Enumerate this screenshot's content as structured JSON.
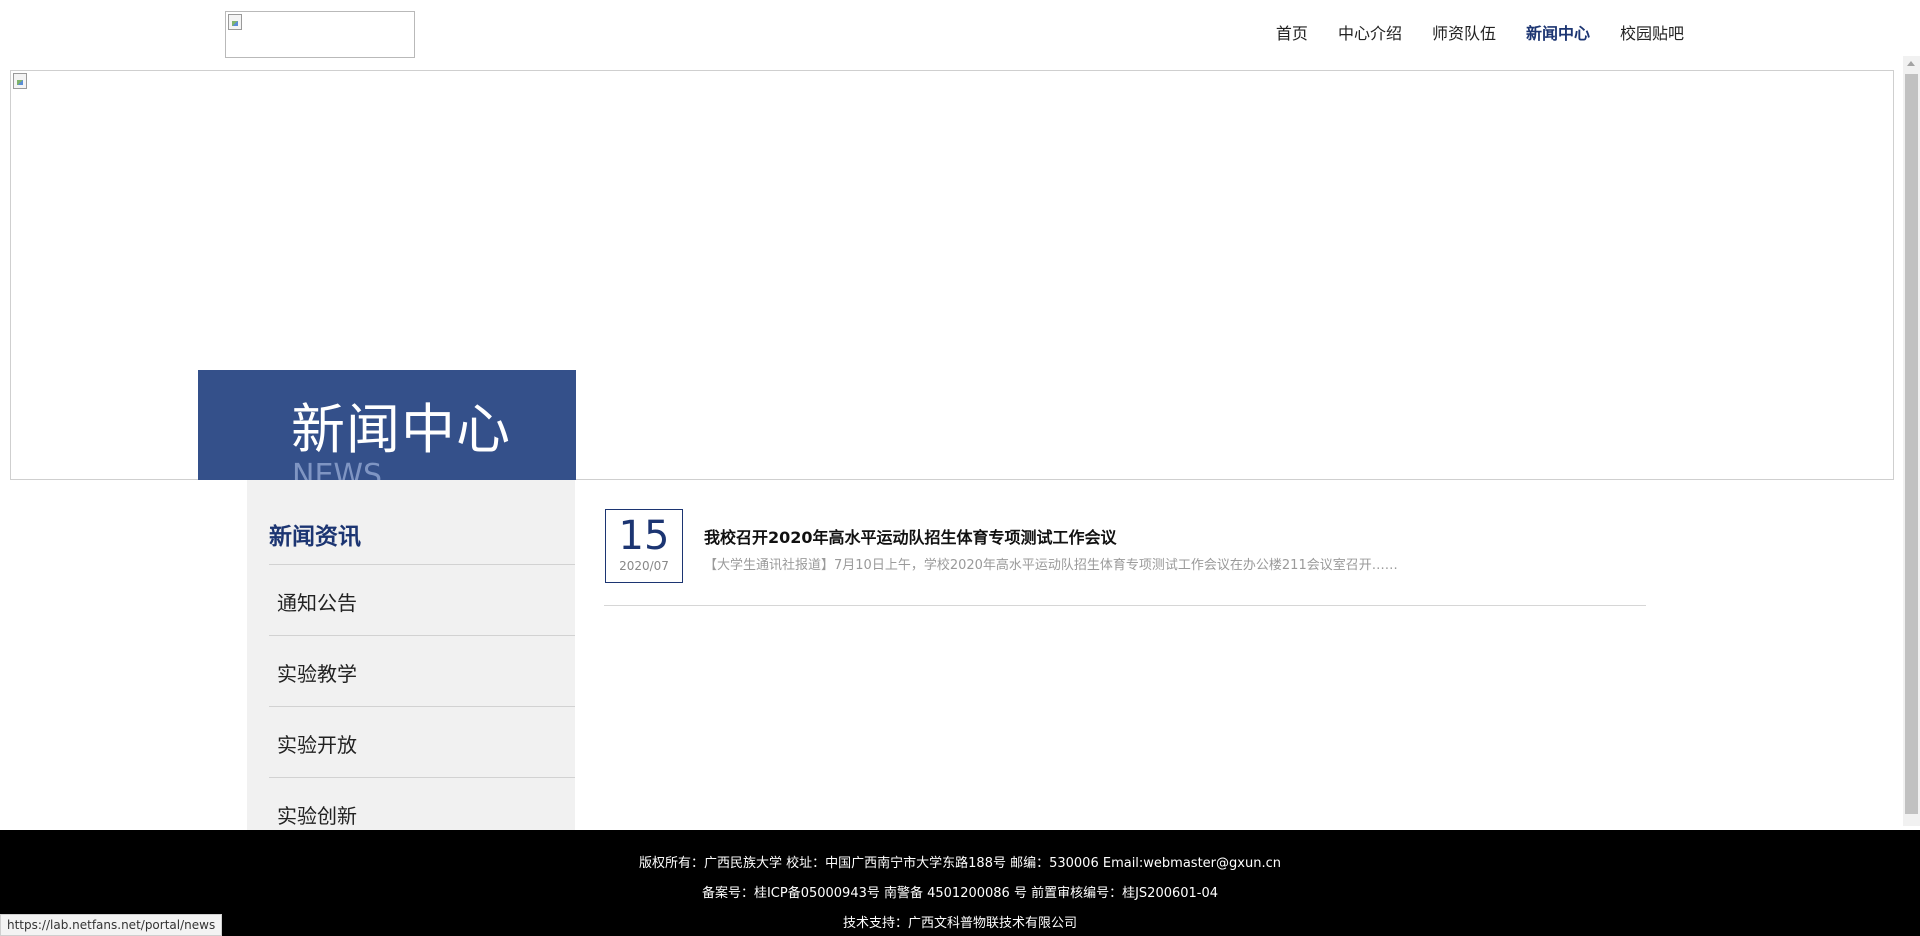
{
  "header": {
    "nav": [
      {
        "label": "首页",
        "active": false
      },
      {
        "label": "中心介绍",
        "active": false
      },
      {
        "label": "师资队伍",
        "active": false
      },
      {
        "label": "新闻中心",
        "active": true
      },
      {
        "label": "校园贴吧",
        "active": false
      }
    ]
  },
  "banner": {
    "title_cn": "新闻中心",
    "title_en": "NEWS"
  },
  "sidebar": {
    "heading": "新闻资讯",
    "items": [
      {
        "label": "通知公告"
      },
      {
        "label": "实验教学"
      },
      {
        "label": "实验开放"
      },
      {
        "label": "实验创新"
      }
    ]
  },
  "news": [
    {
      "day": "15",
      "year_month": "2020/07",
      "title": "我校召开2020年高水平运动队招生体育专项测试工作会议",
      "summary": "【大学生通讯社报道】7月10日上午，学校2020年高水平运动队招生体育专项测试工作会议在办公楼211会议室召开……"
    }
  ],
  "footer": {
    "line1": "版权所有：广西民族大学    校址：中国广西南宁市大学东路188号    邮编：530006 Email:webmaster@gxun.cn",
    "line2": "备案号：桂ICP备05000943号 南警备 4501200086 号 前置审核编号：桂JS200601-04",
    "line3": "技术支持：广西文科普物联技术有限公司"
  },
  "status_bar": {
    "url": "https://lab.netfans.net/portal/news"
  },
  "colors": {
    "accent": "#1c3572",
    "banner_label_bg": "#34508a",
    "sidebar_bg": "#f1f1f1",
    "footer_bg": "#000000"
  }
}
